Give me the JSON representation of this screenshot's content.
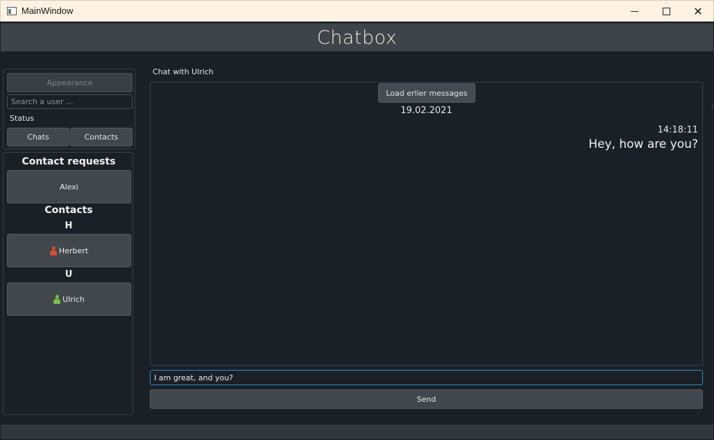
{
  "window": {
    "title": "MainWindow",
    "minimize_icon": "minimize-icon",
    "maximize_icon": "maximize-icon",
    "close_glyph": "✕"
  },
  "header": {
    "brand": "Chatbox"
  },
  "sidebar": {
    "appearance_label": "Appearance",
    "search_placeholder": "Search a user ...",
    "status_label": "Status",
    "tabs": [
      {
        "label": "Chats"
      },
      {
        "label": "Contacts"
      }
    ],
    "contact_requests_title": "Contact requests",
    "contact_requests": [
      {
        "name": "Alexi"
      }
    ],
    "contacts_title": "Contacts",
    "groups": [
      {
        "letter": "H",
        "contacts": [
          {
            "name": "Herbert",
            "status_color": "#d9502e"
          }
        ]
      },
      {
        "letter": "U",
        "contacts": [
          {
            "name": "Ulrich",
            "status_color": "#7ac043"
          }
        ]
      }
    ]
  },
  "chat": {
    "label": "Chat with Ulrich",
    "load_earlier_label": "Load erlier messages",
    "date": "19.02.2021",
    "messages": [
      {
        "time": "14:18:11",
        "text": "Hey, how are you?"
      }
    ],
    "input_value": "I am great, and you?",
    "send_label": "Send"
  }
}
